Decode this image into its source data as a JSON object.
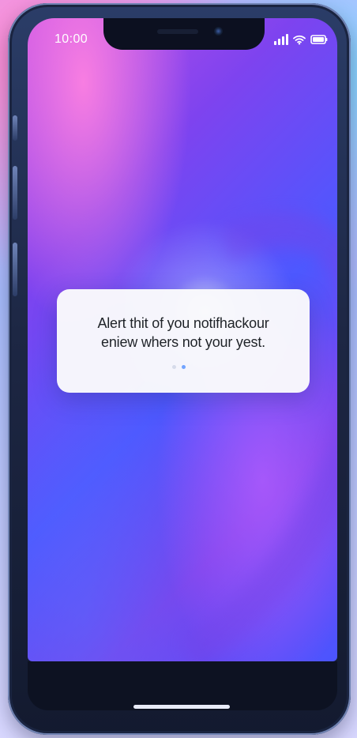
{
  "status_bar": {
    "time": "10:00",
    "signal_icon": "signal-icon",
    "wifi_icon": "wifi-icon",
    "battery_icon": "battery-icon"
  },
  "alert": {
    "line1": "Alert thit of you notifhackour",
    "line2": "eniew whers not your yest.",
    "page_count": 2,
    "active_page": 2
  },
  "colors": {
    "status_text": "#ffffff",
    "alert_background": "#fafafc",
    "alert_text": "#1f2328",
    "active_dot": "#72a4ff"
  }
}
